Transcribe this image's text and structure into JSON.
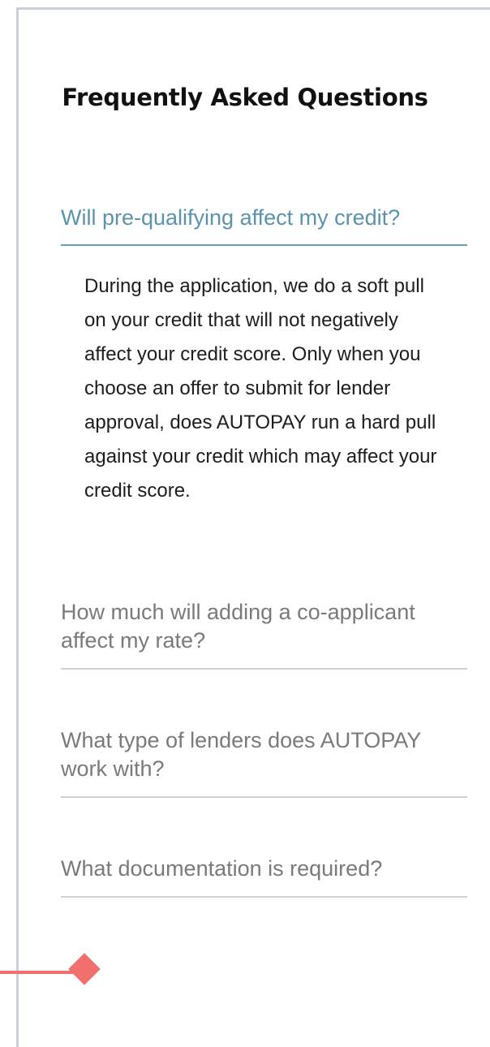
{
  "faq": {
    "title": "Frequently Asked Questions",
    "items": [
      {
        "question": "Will pre-qualifying affect my credit?",
        "answer": "During the application, we do a soft pull on your credit that will not negatively affect your credit score. Only when you choose an offer to submit for lender approval, does AUTOPAY run a hard pull against your credit which may affect your credit score.",
        "expanded": true
      },
      {
        "question": "How much will adding a co-applicant affect my rate?",
        "expanded": false
      },
      {
        "question": "What type of lenders does AUTOPAY work with?",
        "expanded": false
      },
      {
        "question": "What documentation is required?",
        "expanded": false
      }
    ]
  },
  "colors": {
    "accent_open": "#5b93ad",
    "question_closed": "#7a7a7a",
    "decor_accent": "#f26f6f",
    "frame": "#c8cfdd"
  }
}
